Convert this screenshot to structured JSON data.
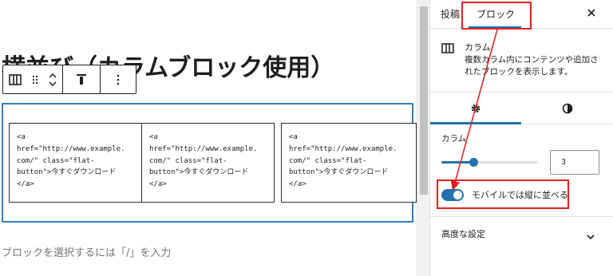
{
  "editor": {
    "heading": "横並び（カラムブロック使用）",
    "toolbar": {
      "block_icon": "columns-icon",
      "drag_icon": "drag-handle-icon",
      "move_up_icon": "chevron-up-icon",
      "move_down_icon": "chevron-down-icon",
      "align_icon": "align-top-icon",
      "more_icon": "more-vertical-icon"
    },
    "columns": [
      {
        "code": "<a\nhref=\"http://www.example.\ncom/\" class=\"flat-\nbutton\">今すぐダウンロード\n</a>"
      },
      {
        "code": "<a\nhref=\"http://www.example.\ncom/\" class=\"flat-\nbutton\">今すぐダウンロード\n</a>"
      },
      {
        "code": "<a\nhref=\"http://www.example.\ncom/\" class=\"flat-\nbutton\">今すぐダウンロード\n</a>"
      }
    ],
    "placeholder": "ブロックを選択するには「/」を入力"
  },
  "sidebar": {
    "tabs": [
      {
        "label": "投稿"
      },
      {
        "label": "ブロック"
      }
    ],
    "active_tab": "ブロック",
    "close_icon": "close-icon",
    "block": {
      "icon": "columns-icon",
      "name": "カラム",
      "description": "複数カラム内にコンテンツや追加されたブロックを表示します。"
    },
    "style_tabs": {
      "settings_icon": "gear-icon",
      "styles_icon": "contrast-icon"
    },
    "settings": {
      "columns_label": "カラム",
      "columns_value": "3",
      "slider_fraction": 0.33,
      "stack_on_mobile_label": "モバイルでは縦に並べる",
      "stack_on_mobile": true
    },
    "advanced_label": "高度な設定"
  },
  "colors": {
    "accent": "#2271b1",
    "selection_border": "#2f7ec4",
    "annotation": "#e02020"
  }
}
